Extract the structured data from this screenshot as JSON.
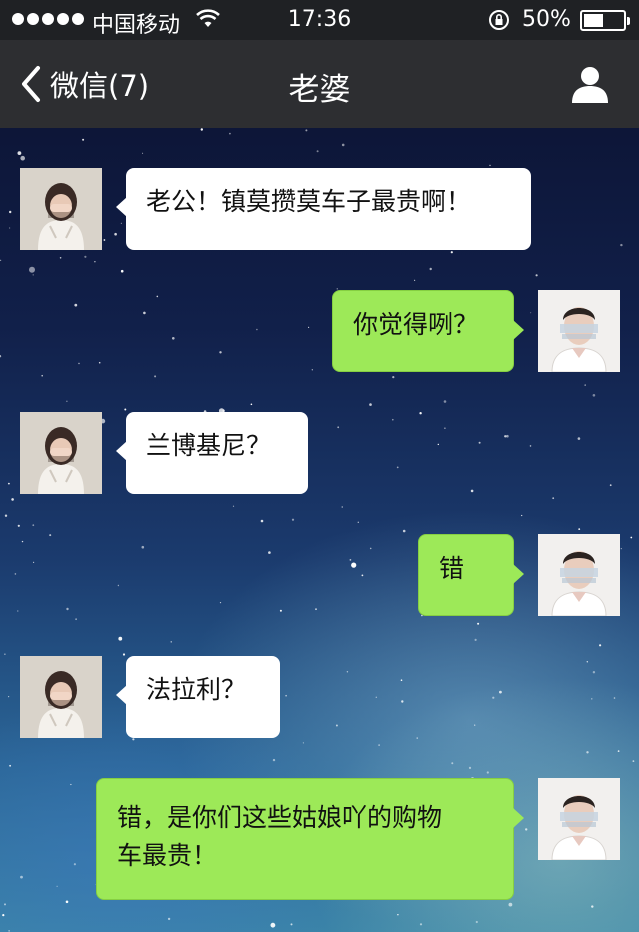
{
  "status_bar": {
    "carrier": "中国移动",
    "time": "17:36",
    "battery": "50%",
    "battery_level": 0.5
  },
  "nav": {
    "back_label": "微信(7)",
    "title": "老婆"
  },
  "messages": [
    {
      "sender": "wife",
      "text": "老公！镇莫攒莫车子最贵啊！"
    },
    {
      "sender": "me",
      "text": "你觉得咧？"
    },
    {
      "sender": "wife",
      "text": "兰博基尼？"
    },
    {
      "sender": "me",
      "text": "错"
    },
    {
      "sender": "wife",
      "text": "法拉利？"
    },
    {
      "sender": "me",
      "text_lines": [
        "错，是你们这些姑娘吖的购物",
        "车最贵！"
      ]
    }
  ],
  "colors": {
    "outgoing_bubble": "#9de958",
    "incoming_bubble": "#ffffff",
    "nav_bar": "#2d2e31",
    "status_bar": "#1f2124"
  }
}
